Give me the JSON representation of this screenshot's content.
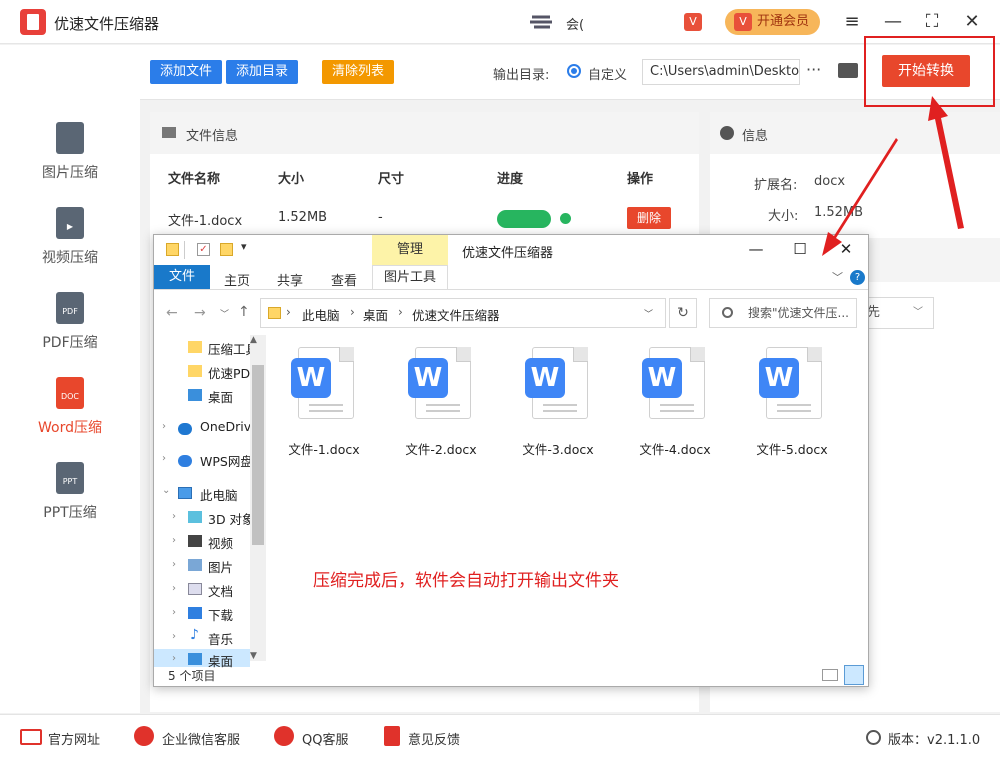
{
  "app": {
    "title": "优速文件压缩器",
    "user_name": "会(",
    "vip_label": "开通会员"
  },
  "window_controls": {
    "menu": "≡",
    "minimize": "—",
    "maximize": "⛶",
    "close": "✕"
  },
  "sidebar": {
    "items": [
      {
        "label": "图片压缩",
        "icon": "image-file-icon",
        "icon_text": "",
        "active": false
      },
      {
        "label": "视频压缩",
        "icon": "video-file-icon",
        "icon_text": "▶",
        "active": false
      },
      {
        "label": "PDF压缩",
        "icon": "pdf-file-icon",
        "icon_text": "PDF",
        "active": false
      },
      {
        "label": "Word压缩",
        "icon": "word-file-icon",
        "icon_text": "DOC",
        "active": true
      },
      {
        "label": "PPT压缩",
        "icon": "ppt-file-icon",
        "icon_text": "PPT",
        "active": false
      }
    ]
  },
  "toolbar": {
    "add_file": "添加文件",
    "add_dir": "添加目录",
    "clear_list": "清除列表",
    "output_label": "输出目录:",
    "custom_label": "自定义",
    "output_path": "C:\\Users\\admin\\Deskto",
    "more": "···",
    "start": "开始转换"
  },
  "file_panel": {
    "title": "文件信息",
    "columns": [
      "文件名称",
      "大小",
      "尺寸",
      "进度",
      "操作"
    ],
    "rows": [
      {
        "name": "文件-1.docx",
        "size": "1.52MB",
        "dim": "-",
        "progress": 1.0,
        "action": "删除"
      }
    ]
  },
  "info_panel": {
    "title": "信息",
    "ext_label": "扩展名:",
    "ext_value": "docx",
    "size_label": "大小:",
    "size_value": "1.52MB",
    "select_value": "先"
  },
  "explorer": {
    "context_tab": "管理",
    "title": "优速文件压缩器",
    "ribbon": {
      "file": "文件",
      "home": "主页",
      "share": "共享",
      "view": "查看",
      "picture_tools": "图片工具"
    },
    "breadcrumb": [
      "此电脑",
      "桌面",
      "优速文件压缩器"
    ],
    "search_placeholder": "搜索\"优速文件压...",
    "tree": [
      {
        "label": "压缩工具",
        "icon": "folder-icon"
      },
      {
        "label": "优速PD",
        "icon": "folder-icon"
      },
      {
        "label": "桌面",
        "icon": "desktop-icon"
      },
      {
        "label": "OneDrive",
        "icon": "cloud-icon"
      },
      {
        "label": "WPS网盘",
        "icon": "wps-cloud-icon"
      },
      {
        "label": "此电脑",
        "icon": "computer-icon"
      },
      {
        "label": "3D 对象",
        "icon": "cube-icon"
      },
      {
        "label": "视频",
        "icon": "film-icon"
      },
      {
        "label": "图片",
        "icon": "picture-icon"
      },
      {
        "label": "文档",
        "icon": "document-icon"
      },
      {
        "label": "下载",
        "icon": "download-icon"
      },
      {
        "label": "音乐",
        "icon": "music-icon"
      },
      {
        "label": "桌面",
        "icon": "desktop-icon"
      }
    ],
    "files": [
      "文件-1.docx",
      "文件-2.docx",
      "文件-3.docx",
      "文件-4.docx",
      "文件-5.docx"
    ],
    "file_badge": "W",
    "status": "5 个项目",
    "note": "压缩完成后，软件会自动打开输出文件夹"
  },
  "footer": {
    "website": "官方网址",
    "wechat": "企业微信客服",
    "qq": "QQ客服",
    "feedback": "意见反馈",
    "version": "版本：v2.1.1.0"
  },
  "colors": {
    "accent_red": "#e8472c",
    "blue": "#2b7de9",
    "orange": "#f39800",
    "green": "#27b55f"
  }
}
